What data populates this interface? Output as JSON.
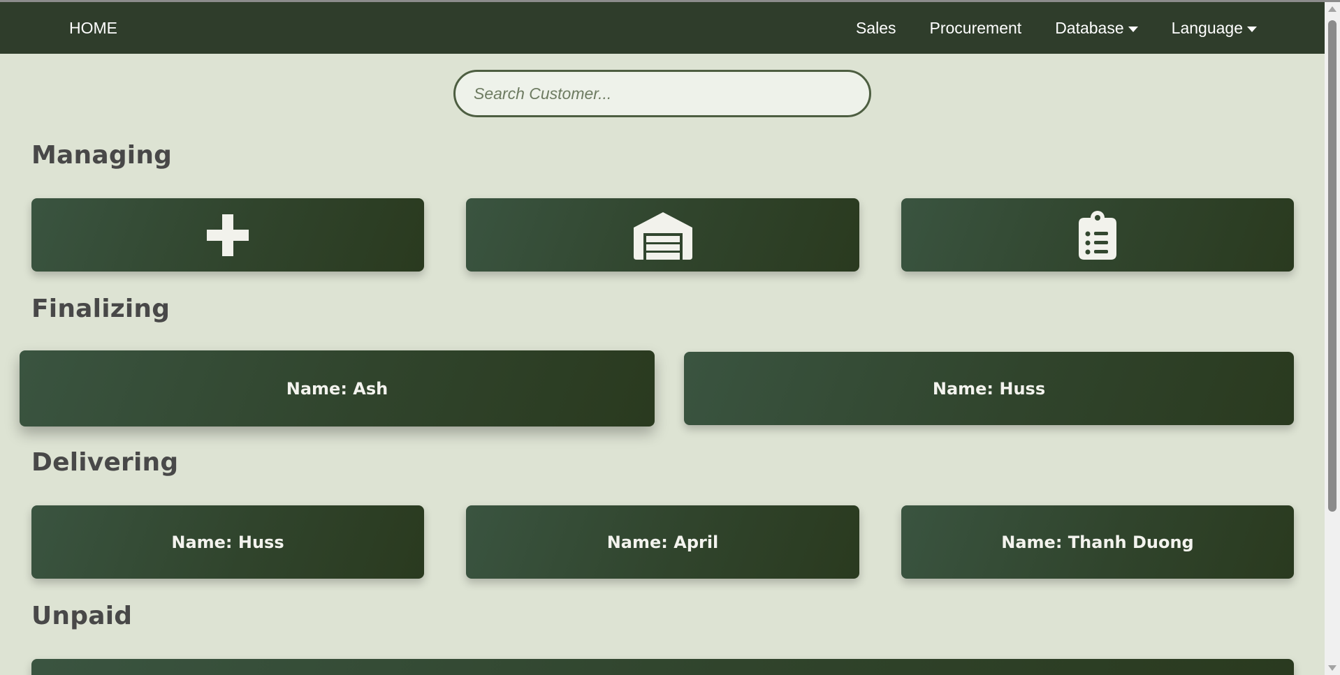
{
  "nav": {
    "home": "HOME",
    "items": [
      {
        "label": "Sales",
        "dropdown": false
      },
      {
        "label": "Procurement",
        "dropdown": false
      },
      {
        "label": "Database",
        "dropdown": true
      },
      {
        "label": "Language",
        "dropdown": true
      }
    ]
  },
  "search": {
    "placeholder": "Search Customer...",
    "value": ""
  },
  "sections": {
    "managing": {
      "title": "Managing",
      "cards": [
        {
          "icon": "plus-icon"
        },
        {
          "icon": "warehouse-icon"
        },
        {
          "icon": "clipboard-list-icon"
        }
      ]
    },
    "finalizing": {
      "title": "Finalizing",
      "cards": [
        {
          "label": "Name: Ash"
        },
        {
          "label": "Name: Huss"
        }
      ]
    },
    "delivering": {
      "title": "Delivering",
      "cards": [
        {
          "label": "Name: Huss"
        },
        {
          "label": "Name: April"
        },
        {
          "label": "Name: Thanh Duong"
        }
      ]
    },
    "unpaid": {
      "title": "Unpaid"
    }
  },
  "colors": {
    "background": "#dde3d3",
    "navbar": "#2f3d2b",
    "card_start": "#3a5440",
    "card_end": "#2a3a1f",
    "heading_text": "#484848",
    "search_border": "#4d5e41"
  }
}
